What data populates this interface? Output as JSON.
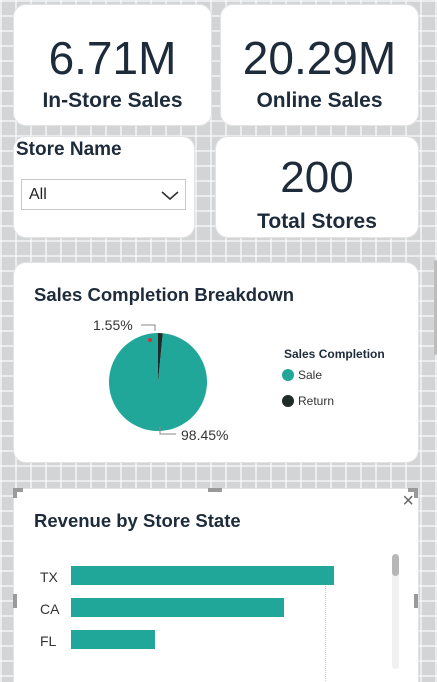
{
  "kpis": {
    "in_store": {
      "value": "6.71M",
      "label": "In-Store Sales"
    },
    "online": {
      "value": "20.29M",
      "label": "Online Sales"
    },
    "total_stores": {
      "value": "200",
      "label": "Total Stores"
    }
  },
  "slicer": {
    "title": "Store Name",
    "selected": "All"
  },
  "pie_card": {
    "title": "Sales Completion Breakdown",
    "legend_title": "Sales Completion",
    "slice_labels": {
      "return": "1.55%",
      "sale": "98.45%"
    }
  },
  "bar_card": {
    "title": "Revenue by Store State",
    "close_glyph": "×"
  },
  "colors": {
    "sale": "#21a79a",
    "return": "#1e2b28",
    "title": "#1d2b3a",
    "canvas": "#d2d4d6"
  },
  "icons": {
    "dropdown": "chevron-down-icon",
    "close": "close-icon"
  },
  "chart_data": [
    {
      "type": "pie",
      "title": "Sales Completion Breakdown",
      "legend_title": "Sales Completion",
      "slices": [
        {
          "name": "Sale",
          "value": 98.45,
          "label": "98.45%",
          "color": "#21a79a"
        },
        {
          "name": "Return",
          "value": 1.55,
          "label": "1.55%",
          "color": "#1e2b28"
        }
      ],
      "legend_position": "right"
    },
    {
      "type": "bar",
      "orientation": "horizontal",
      "title": "Revenue by Store State",
      "categories": [
        "TX",
        "CA",
        "FL"
      ],
      "values": [
        1.0,
        0.81,
        0.32
      ],
      "grid": true
    }
  ]
}
